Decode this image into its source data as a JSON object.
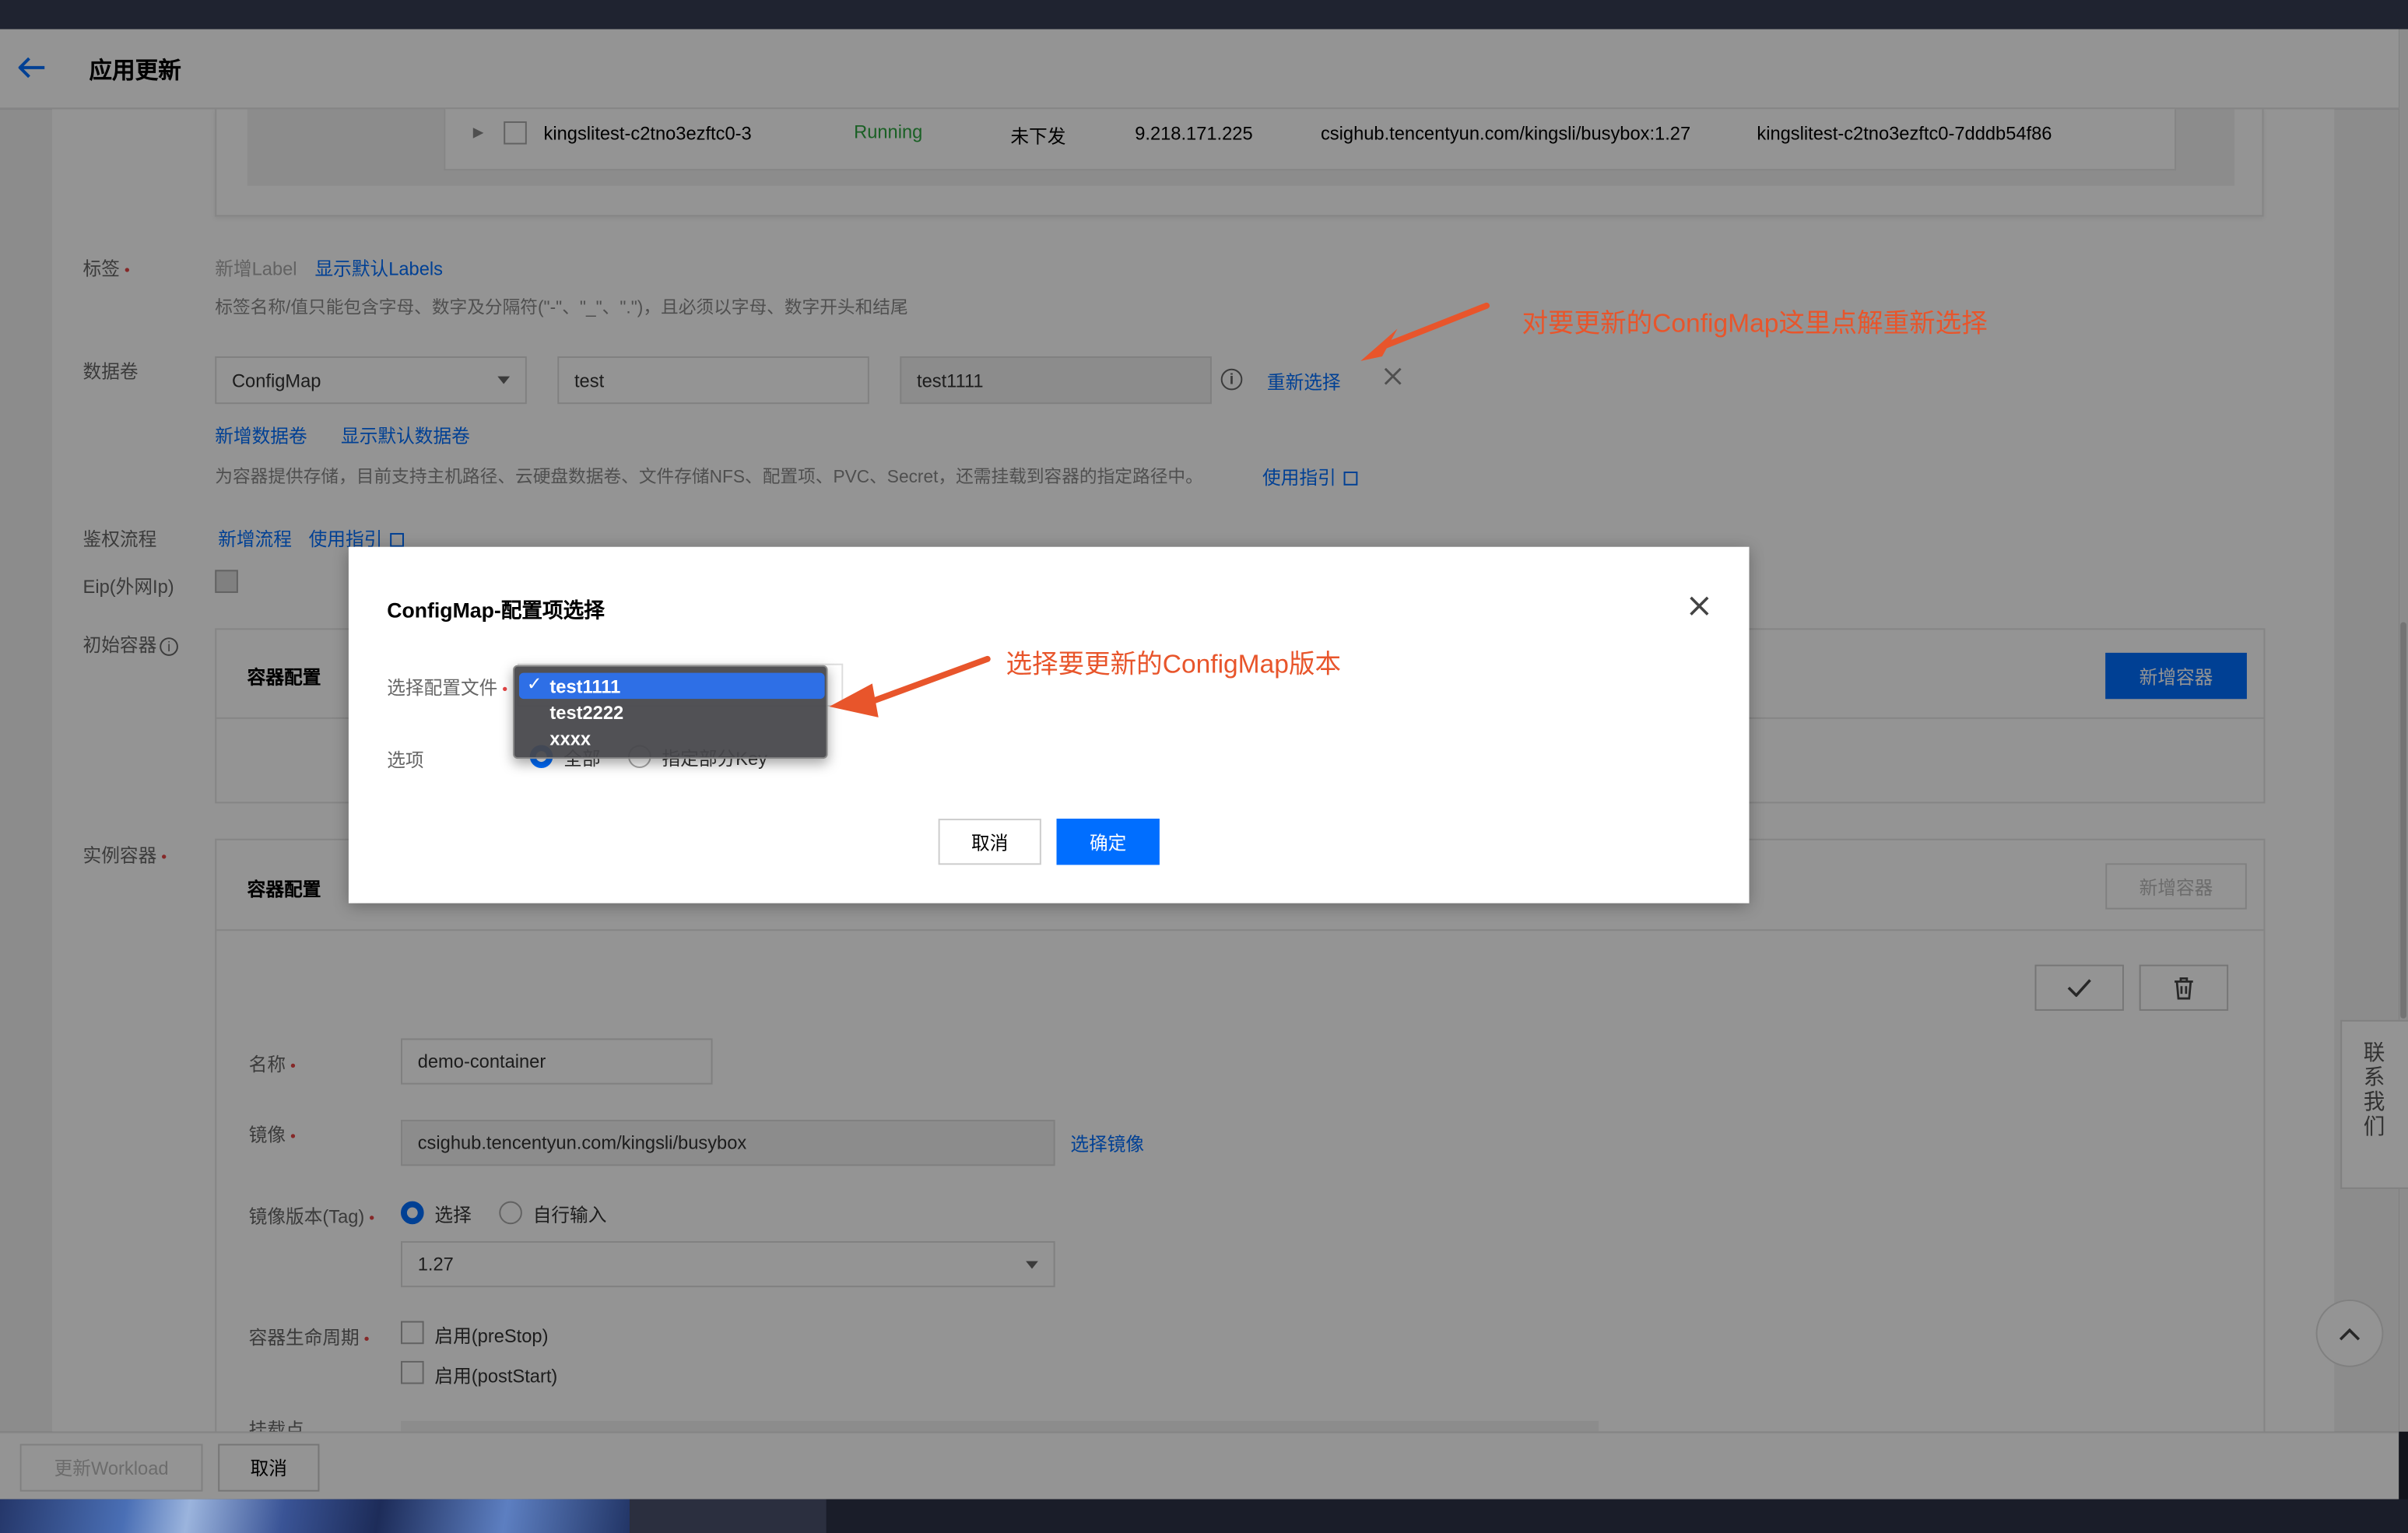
{
  "header": {
    "title": "应用更新"
  },
  "pod_row": {
    "name": "kingslitest-c2tno3ezftc0-3",
    "status": "Running",
    "state": "未下发",
    "ip": "9.218.171.225",
    "image": "csighub.tencentyun.com/kingsli/busybox:1.27",
    "owner": "kingslitest-c2tno3ezftc0-7dddb54f86"
  },
  "labels_section": {
    "label": "标签",
    "placeholder": "新增Label",
    "show_default": "显示默认Labels",
    "hint": "标签名称/值只能包含字母、数字及分隔符(\"-\"、\"_\"、\".\")，且必须以字母、数字开头和结尾"
  },
  "volumes_section": {
    "label": "数据卷",
    "type": "ConfigMap",
    "name": "test",
    "config": "test1111",
    "reselect": "重新选择",
    "add": "新增数据卷",
    "show_default": "显示默认数据卷",
    "hint": "为容器提供存储，目前支持主机路径、云硬盘数据卷、文件存储NFS、配置项、PVC、Secret，还需挂载到容器的指定路径中。",
    "guide": "使用指引"
  },
  "auth_section": {
    "label": "鉴权流程",
    "add": "新增流程",
    "guide": "使用指引"
  },
  "eip_section": {
    "label": "Eip(外网Ip)"
  },
  "init_container": {
    "label": "初始容器",
    "config_title": "容器配置",
    "add_button": "新增容器"
  },
  "instance_container": {
    "label": "实例容器",
    "config_title": "容器配置",
    "add_button": "新增容器",
    "name_label": "名称",
    "name_value": "demo-container",
    "image_label": "镜像",
    "image_value": "csighub.tencentyun.com/kingsli/busybox",
    "select_image": "选择镜像",
    "tag_label": "镜像版本(Tag)",
    "tag_opt_select": "选择",
    "tag_opt_manual": "自行输入",
    "tag_value": "1.27",
    "lifecycle_label": "容器生命周期",
    "prestop": "启用(preStop)",
    "poststart": "启用(postStart)",
    "mount_label": "挂载点"
  },
  "footer": {
    "update_button": "更新Workload",
    "cancel_button": "取消"
  },
  "modal": {
    "title": "ConfigMap-配置项选择",
    "file_label": "选择配置文件",
    "option_label": "选项",
    "radio_all": "全部",
    "radio_partial": "指定部分Key",
    "options": [
      "test1111",
      "test2222",
      "xxxx"
    ],
    "selected": "test1111",
    "cancel": "取消",
    "confirm": "确定"
  },
  "annotations": {
    "top": "对要更新的ConfigMap这里点解重新选择",
    "dropdown": "选择要更新的ConfigMap版本"
  },
  "side": {
    "contact": "联系我们"
  },
  "colors": {
    "accent": "#006eff",
    "annotation": "#e8552b",
    "running": "#2da641",
    "required": "#e54545"
  }
}
